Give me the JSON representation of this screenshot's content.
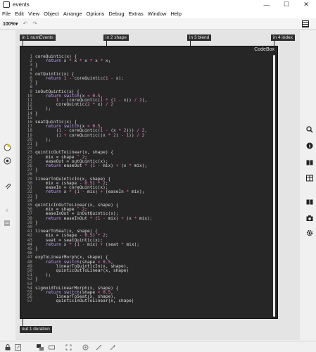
{
  "window": {
    "title": "events",
    "minimize": "—",
    "maximize": "☐",
    "close": "✕"
  },
  "menu": [
    "File",
    "Edit",
    "View",
    "Object",
    "Arrange",
    "Options",
    "Debug",
    "Extras",
    "Window",
    "Help"
  ],
  "toolbar": {
    "zoom": "100%",
    "zoom_caret": "▾",
    "undo": "↶",
    "redo": "↷"
  },
  "inlets": [
    {
      "label": "in 1 numEvents"
    },
    {
      "label": "in 2 shape"
    },
    {
      "label": "in 3 blend"
    },
    {
      "label": "in 4 index"
    }
  ],
  "codebox": {
    "title": "CodeBox"
  },
  "outlet": {
    "label": "out 1 duration"
  },
  "code_lines": [
    "coreQuintic(x) {",
    "    return x * x * x * x * x;",
    "}",
    "",
    "outQuintic(x) {",
    "    return 1 - coreQuintic(1 - x);",
    "}",
    "",
    "inOutQuintic(x) {",
    "    return switch(x < 0.5,",
    "        1 - (coreQuintic(1 * (1 - x)) / 2),",
    "        coreQuintic(2 * x) / 2",
    "    );",
    "}",
    "",
    "seatQuintic(x) {",
    "    return switch(x < 0.5,",
    "        (1 - coreQuintic(1 - (x * 2))) / 2,",
    "        (1 + coreQuintic((x * 2) - 1)) / 2",
    "    );",
    "}",
    "",
    "quinticOutToLinear(x, shape) {",
    "    mix = shape ^ 2;",
    "    easeOut = outQuintic(x);",
    "    return easeOut * (1 - mix) + (x * mix);",
    "}",
    "",
    "linearToQuinticIn(x, shape) {",
    "    mix = (shape - 0.5) * 2;",
    "    easeIn = coreQuintic(x);",
    "    return x * (1 - mix) + (easeIn * mix);",
    "}",
    "",
    "quinticInOutToLinear(x, shape) {",
    "    mix = shape ^ 2;",
    "    easeInOut = inOutQuintic(x);",
    "    return easeInOut * (1 - mix) + (x * mix);",
    "}",
    "",
    "linearToSeat(x, shape) {",
    "    mix = (shape - 0.5) * 2;",
    "    seat = seatQuintic(x);",
    "    return x * (1 - mix) + (seat * mix);",
    "}",
    "",
    "expToLinearMorph(x, shape) {",
    "    return switch(shape < 0.5,",
    "        linearToQuinticIn(x, shape),",
    "        quinticOutToLinear(x, shape)",
    "    );",
    "}",
    "",
    "sigmoidToLinearMorph(x, shape) {",
    "    return switch(shape < 0.5,",
    "        linearToSeat(x, shape),",
    "        quinticInOutToLinear(x, shape)"
  ],
  "left_icons": [
    "palette-icon",
    "target-icon",
    "paperclip-icon",
    "plus-icon",
    "minus-icon"
  ],
  "right_icons": [
    "search-icon",
    "info-icon",
    "book-icon",
    "table-icon",
    "book2-icon",
    "camera-icon",
    "gear-icon"
  ],
  "status_icons": [
    "lock-icon",
    "presentation-icon",
    "grid-icon",
    "layers-icon",
    "frame-icon",
    "debug-icon",
    "wand-icon"
  ]
}
